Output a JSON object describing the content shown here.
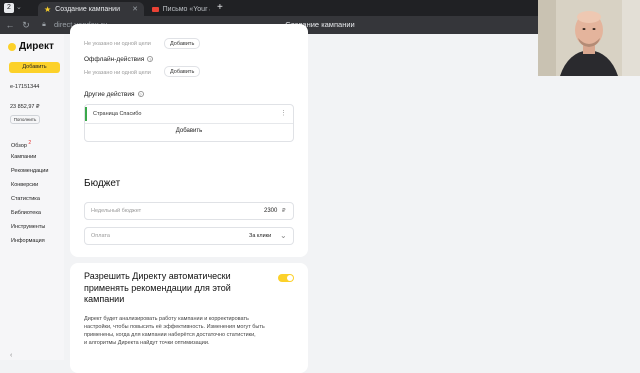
{
  "browser": {
    "tab_count": "2",
    "tabs": [
      {
        "title": "Создание кампании",
        "active": true
      },
      {
        "title": "Письмо «Your account on",
        "active": false
      }
    ],
    "new_tab_label": "+",
    "url": "direct.yandex.ru",
    "page_title": "Создание кампании"
  },
  "sidebar": {
    "logo_text": "Директ",
    "add_button": "Добавить",
    "account_id": "e-17151344",
    "balance": "23 852,97 ₽",
    "topup_button": "Пополнить",
    "nav": [
      {
        "label": "Обзор",
        "badge": "2"
      },
      {
        "label": "Кампании"
      },
      {
        "label": "Рекомендации"
      },
      {
        "label": "Конверсии"
      },
      {
        "label": "Статистика"
      },
      {
        "label": "Библиотека"
      },
      {
        "label": "Инструменты"
      },
      {
        "label": "Информация"
      }
    ],
    "collapse_glyph": "‹"
  },
  "goals_card": {
    "top_muted": "Не указано ни одной цели",
    "top_add": "Добавить",
    "offline_label": "Оффлайн-действия",
    "offline_muted": "Не указано ни одной цели",
    "offline_add": "Добавить",
    "other_label": "Другие действия",
    "other_item": "Страница Спасибо",
    "other_add": "Добавить"
  },
  "budget_card": {
    "title": "Бюджет",
    "weekly_placeholder": "Недельный бюджет",
    "weekly_value": "2300",
    "currency": "₽",
    "payment_label": "Оплата",
    "payment_value": "За клики"
  },
  "reco_card": {
    "title_line1": "Разрешить Директу автоматически",
    "title_line2": "применять рекомендации для этой",
    "title_line3": "кампании",
    "desc_line1": "Директ будет анализировать работу кампании и корректировать",
    "desc_line2": "настройки, чтобы повысить её эффективность. Изменения могут быть",
    "desc_line3": "применены, когда для кампании наберётся достаточно статистики,",
    "desc_line4": "и алгоритмы Директа найдут точки оптимизации.",
    "toggle_on": true
  },
  "colors": {
    "accent": "#fcd12a",
    "page_bg": "#f2f3f5",
    "card_bg": "#ffffff",
    "selected_item_bar": "#3aa84a"
  }
}
